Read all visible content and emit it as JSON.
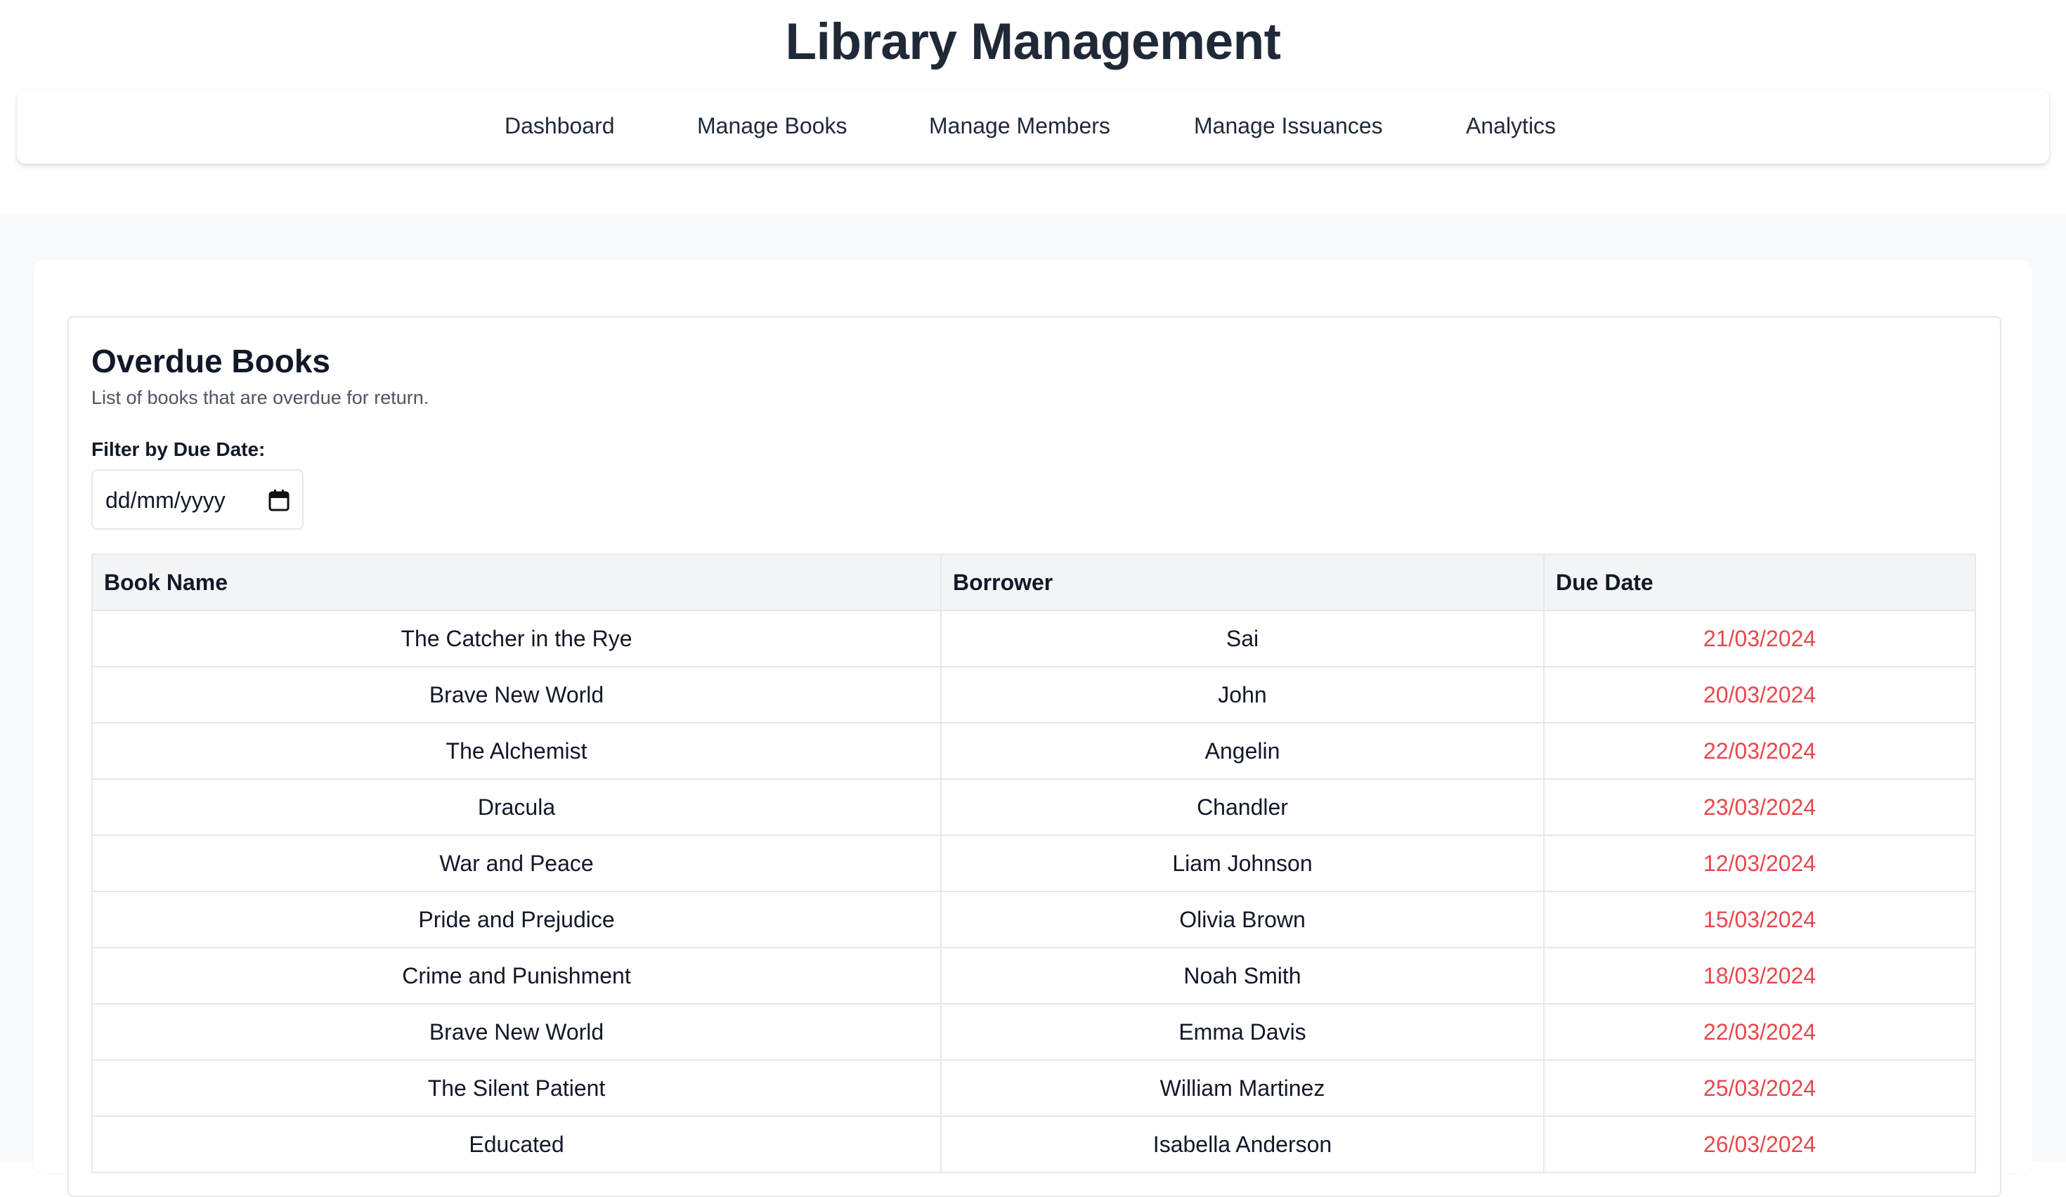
{
  "app": {
    "title": "Library Management"
  },
  "nav": {
    "items": [
      {
        "label": "Dashboard"
      },
      {
        "label": "Manage Books"
      },
      {
        "label": "Manage Members"
      },
      {
        "label": "Manage Issuances"
      },
      {
        "label": "Analytics"
      }
    ]
  },
  "overdue": {
    "title": "Overdue Books",
    "subtitle": "List of books that are overdue for return.",
    "filter_label": "Filter by Due Date:",
    "date_placeholder": "dd/mm/yyyy",
    "calendar_icon": "calendar-icon",
    "columns": [
      "Book Name",
      "Borrower",
      "Due Date"
    ],
    "rows": [
      {
        "book": "The Catcher in the Rye",
        "borrower": "Sai",
        "due": "21/03/2024"
      },
      {
        "book": "Brave New World",
        "borrower": "John",
        "due": "20/03/2024"
      },
      {
        "book": "The Alchemist",
        "borrower": "Angelin",
        "due": "22/03/2024"
      },
      {
        "book": "Dracula",
        "borrower": "Chandler",
        "due": "23/03/2024"
      },
      {
        "book": "War and Peace",
        "borrower": "Liam Johnson",
        "due": "12/03/2024"
      },
      {
        "book": "Pride and Prejudice",
        "borrower": "Olivia Brown",
        "due": "15/03/2024"
      },
      {
        "book": "Crime and Punishment",
        "borrower": "Noah Smith",
        "due": "18/03/2024"
      },
      {
        "book": "Brave New World",
        "borrower": "Emma Davis",
        "due": "22/03/2024"
      },
      {
        "book": "The Silent Patient",
        "borrower": "William Martinez",
        "due": "25/03/2024"
      },
      {
        "book": "Educated",
        "borrower": "Isabella Anderson",
        "due": "26/03/2024"
      }
    ]
  },
  "colors": {
    "overdue_date": "#e5484d",
    "header_bg": "#f3f4f6",
    "page_bg": "#f8f9fb"
  }
}
